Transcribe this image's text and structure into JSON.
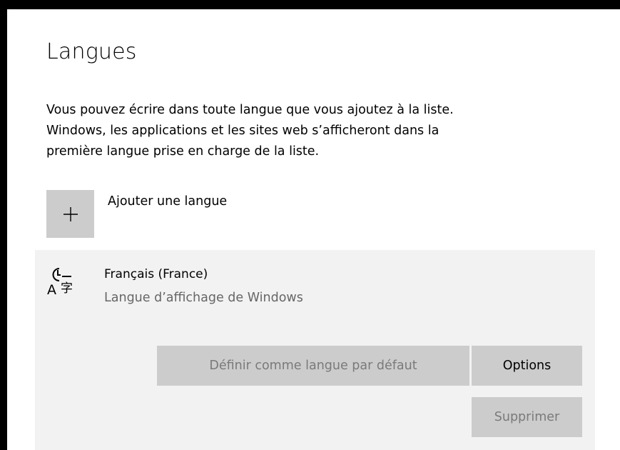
{
  "page": {
    "title": "Langues",
    "description_lines": [
      "Vous pouvez écrire dans toute langue que vous ajoutez à la liste.",
      "Windows, les applications et les sites web s’afficheront dans la",
      "première langue prise en charge de la liste."
    ]
  },
  "add_language": {
    "label": "Ajouter une langue",
    "icon": "plus-icon"
  },
  "language_item": {
    "name": "Français (France)",
    "subtitle": "Langue d’affichage de Windows",
    "icon": "language-display-icon",
    "buttons": {
      "set_default": "Définir comme langue par défaut",
      "options": "Options",
      "remove": "Supprimer"
    }
  },
  "colors": {
    "tile_gray": "#cccccc",
    "panel_bg": "#f2f2f2",
    "disabled_text": "#7a7a7a",
    "secondary_text": "#666666"
  }
}
